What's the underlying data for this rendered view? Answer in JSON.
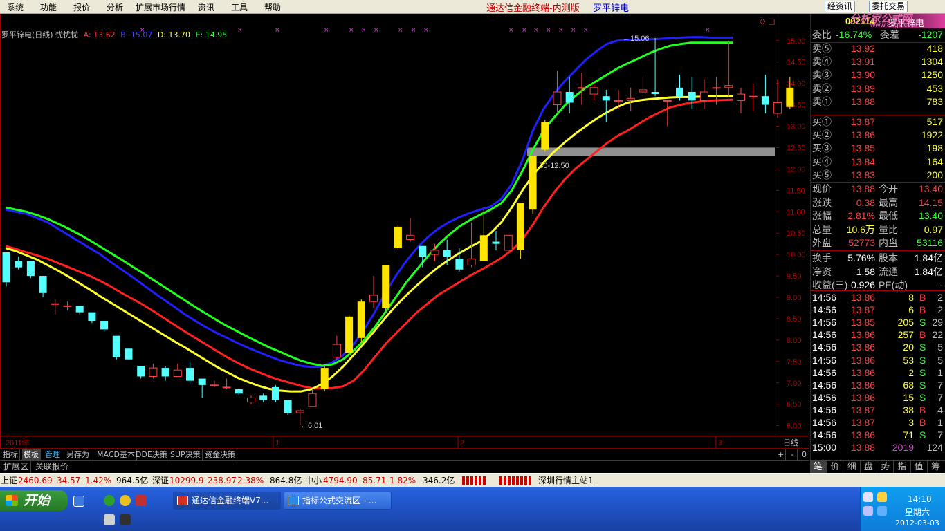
{
  "menu": {
    "items": [
      "系统",
      "功能",
      "报价",
      "分析",
      "扩展市场行情",
      "资讯",
      "工具",
      "帮助"
    ]
  },
  "app_title": "通达信金融终端-内测版",
  "stock_title": "罗平锌电",
  "top_buttons": [
    "经资讯",
    "委托交易"
  ],
  "legend": {
    "name": "罗平锌电(日线) 忧忧忧",
    "a": "A: 13.62",
    "b": "B: 15.07",
    "d": "D: 13.70",
    "e": "E: 14.95",
    "colors": {
      "a": "#ff3030",
      "b": "#4040ff",
      "d": "#ffff40",
      "e": "#40ff40"
    }
  },
  "chart_labels": {
    "high_mark": "15.06",
    "low_mark": "6.01",
    "band": "12.30-12.50",
    "date_year": "2011年",
    "date_1": "1",
    "date_2": "2",
    "date_3": "3",
    "period": "日线"
  },
  "chart_data": {
    "type": "candlestick",
    "ylim": [
      5.8,
      15.4
    ],
    "yticks": [
      "15.00",
      "14.50",
      "14.00",
      "13.50",
      "13.00",
      "12.50",
      "12.00",
      "11.50",
      "11.00",
      "10.50",
      "10.00",
      "9.50",
      "9.00",
      "8.50",
      "8.00",
      "7.50",
      "7.00",
      "6.50",
      "6.00"
    ],
    "candles": [
      [
        10.05,
        9.35,
        10.05,
        9.25
      ],
      [
        9.85,
        9.7,
        9.95,
        9.65
      ],
      [
        9.85,
        9.5,
        9.85,
        9.45
      ],
      [
        9.5,
        9.1,
        9.5,
        9.0
      ],
      [
        8.85,
        8.85,
        8.95,
        8.6
      ],
      [
        8.8,
        8.8,
        8.9,
        8.7
      ],
      [
        8.8,
        8.65,
        8.8,
        8.6
      ],
      [
        8.65,
        8.45,
        8.65,
        8.4
      ],
      [
        8.45,
        8.25,
        8.45,
        8.2
      ],
      [
        8.1,
        7.6,
        8.1,
        7.55
      ],
      [
        7.8,
        7.55,
        7.8,
        7.55
      ],
      [
        7.4,
        7.15,
        7.4,
        7.1
      ],
      [
        7.15,
        7.35,
        7.45,
        7.1
      ],
      [
        7.35,
        7.15,
        7.4,
        7.05
      ],
      [
        7.15,
        7.3,
        7.45,
        7.15
      ],
      [
        7.35,
        7.05,
        7.5,
        7.0
      ],
      [
        7.1,
        6.95,
        7.1,
        6.65
      ],
      [
        6.95,
        6.95,
        7.05,
        6.9
      ],
      [
        6.9,
        6.9,
        7.1,
        6.85
      ],
      [
        6.85,
        6.75,
        6.85,
        6.7
      ],
      [
        6.55,
        6.65,
        6.7,
        6.5
      ],
      [
        6.7,
        6.6,
        6.75,
        6.55
      ],
      [
        6.9,
        6.6,
        6.95,
        6.55
      ],
      [
        6.6,
        6.3,
        6.6,
        6.25
      ],
      [
        6.3,
        6.35,
        6.4,
        6.01
      ],
      [
        6.45,
        6.75,
        6.85,
        6.45
      ],
      [
        6.85,
        7.35,
        7.4,
        6.8
      ],
      [
        7.6,
        7.9,
        8.1,
        7.55
      ],
      [
        7.7,
        8.55,
        8.6,
        7.7
      ],
      [
        8.05,
        8.9,
        8.95,
        7.95
      ],
      [
        8.9,
        9.05,
        9.5,
        8.75
      ],
      [
        8.75,
        9.75,
        9.75,
        8.7
      ],
      [
        10.15,
        10.65,
        10.7,
        10.1
      ],
      [
        10.35,
        10.45,
        10.85,
        10.3
      ],
      [
        10.2,
        9.95,
        10.2,
        9.7
      ],
      [
        10.0,
        10.1,
        10.25,
        9.85
      ],
      [
        10.1,
        9.95,
        10.35,
        9.75
      ],
      [
        9.9,
        9.65,
        10.15,
        9.6
      ],
      [
        9.75,
        9.9,
        10.75,
        9.7
      ],
      [
        9.85,
        10.45,
        11.05,
        9.85
      ],
      [
        10.3,
        10.25,
        10.55,
        10.1
      ],
      [
        10.1,
        10.45,
        10.45,
        10.1
      ],
      [
        10.1,
        11.2,
        11.2,
        9.9
      ],
      [
        11.05,
        12.3,
        12.3,
        10.95
      ],
      [
        12.45,
        13.1,
        13.15,
        12.4
      ],
      [
        13.5,
        13.8,
        14.3,
        13.3
      ],
      [
        13.8,
        13.55,
        14.15,
        13.3
      ],
      [
        13.9,
        13.9,
        14.25,
        13.5
      ],
      [
        13.75,
        13.9,
        14.0,
        13.6
      ],
      [
        13.7,
        13.6,
        13.85,
        13.1
      ],
      [
        13.6,
        13.6,
        13.85,
        13.4
      ],
      [
        13.6,
        13.65,
        13.9,
        13.35
      ],
      [
        13.8,
        13.85,
        14.15,
        13.7
      ],
      [
        13.8,
        13.75,
        15.06,
        13.7
      ],
      [
        13.6,
        13.6,
        13.6,
        13.0
      ],
      [
        13.9,
        13.7,
        14.2,
        13.6
      ],
      [
        13.8,
        13.6,
        14.15,
        13.4
      ],
      [
        13.6,
        13.8,
        14.1,
        13.4
      ],
      [
        13.9,
        13.9,
        14.15,
        13.5
      ],
      [
        13.9,
        13.95,
        15.0,
        13.7
      ],
      [
        13.6,
        13.75,
        13.9,
        13.3
      ],
      [
        13.7,
        13.7,
        14.0,
        13.35
      ],
      [
        13.7,
        13.5,
        14.2,
        13.3
      ],
      [
        13.3,
        13.55,
        14.1,
        13.2
      ],
      [
        13.45,
        13.9,
        14.15,
        13.4
      ]
    ],
    "series": [
      {
        "name": "A",
        "color": "#ff2020",
        "values": [
          10.2,
          10.13,
          10.05,
          9.98,
          9.9,
          9.8,
          9.7,
          9.6,
          9.5,
          9.38,
          9.25,
          9.1,
          8.97,
          8.83,
          8.68,
          8.52,
          8.36,
          8.2,
          8.05,
          7.9,
          7.75,
          7.6,
          7.47,
          7.35,
          7.25,
          7.15,
          7.07,
          7.0,
          6.93,
          6.88,
          6.87,
          6.88,
          6.92,
          7.05,
          7.3,
          7.6,
          7.9,
          8.15,
          8.4,
          8.65,
          8.85,
          9.05,
          9.2,
          9.35,
          9.5,
          9.63,
          9.77,
          9.92,
          10.1,
          10.35,
          10.7,
          11.1,
          11.45,
          11.75,
          12.0,
          12.2,
          12.4,
          12.6,
          12.77,
          12.9,
          13.05,
          13.2,
          13.32,
          13.44,
          13.5,
          13.55,
          13.58,
          13.6,
          13.61,
          13.62
        ]
      },
      {
        "name": "B",
        "color": "#2020ff",
        "values": [
          11.05,
          11.0,
          10.95,
          10.85,
          10.75,
          10.6,
          10.45,
          10.3,
          10.15,
          10.0,
          9.82,
          9.65,
          9.48,
          9.3,
          9.12,
          8.95,
          8.78,
          8.6,
          8.45,
          8.3,
          8.17,
          8.05,
          7.93,
          7.82,
          7.72,
          7.62,
          7.53,
          7.46,
          7.4,
          7.37,
          7.38,
          7.48,
          7.65,
          7.9,
          8.25,
          8.65,
          9.1,
          9.5,
          9.85,
          10.15,
          10.4,
          10.6,
          10.75,
          10.87,
          10.97,
          11.05,
          11.12,
          11.3,
          11.65,
          12.2,
          12.9,
          13.4,
          13.75,
          14.05,
          14.3,
          14.55,
          14.75,
          14.92,
          15.0,
          15.02,
          15.02,
          15.03,
          15.04,
          15.06,
          15.07,
          15.08,
          15.08,
          15.07,
          15.07,
          15.07
        ]
      },
      {
        "name": "D",
        "color": "#ffff30",
        "values": [
          10.15,
          10.08,
          9.98,
          9.88,
          9.75,
          9.62,
          9.48,
          9.33,
          9.18,
          9.02,
          8.87,
          8.72,
          8.57,
          8.42,
          8.27,
          8.12,
          7.97,
          7.83,
          7.68,
          7.53,
          7.38,
          7.25,
          7.12,
          7.02,
          6.93,
          6.86,
          6.82,
          6.8,
          6.8,
          6.85,
          6.97,
          7.15,
          7.38,
          7.65,
          7.93,
          8.22,
          8.52,
          8.8,
          9.05,
          9.28,
          9.5,
          9.7,
          9.87,
          10.03,
          10.17,
          10.3,
          10.5,
          10.75,
          11.1,
          11.5,
          11.85,
          12.15,
          12.4,
          12.62,
          12.82,
          13.0,
          13.17,
          13.32,
          13.45,
          13.55,
          13.6,
          13.63,
          13.65,
          13.67,
          13.68,
          13.68,
          13.69,
          13.7,
          13.7,
          13.7
        ]
      },
      {
        "name": "E",
        "color": "#20ff20",
        "values": [
          11.1,
          11.05,
          11.0,
          10.92,
          10.83,
          10.72,
          10.6,
          10.47,
          10.33,
          10.18,
          10.03,
          9.88,
          9.72,
          9.57,
          9.41,
          9.25,
          9.09,
          8.93,
          8.77,
          8.62,
          8.47,
          8.33,
          8.2,
          8.07,
          7.95,
          7.83,
          7.73,
          7.62,
          7.52,
          7.45,
          7.4,
          7.43,
          7.55,
          7.75,
          8.0,
          8.3,
          8.65,
          9.0,
          9.35,
          9.65,
          9.95,
          10.22,
          10.45,
          10.65,
          10.8,
          10.93,
          11.05,
          11.2,
          11.5,
          11.95,
          12.45,
          12.9,
          13.2,
          13.48,
          13.7,
          13.9,
          14.05,
          14.2,
          14.35,
          14.47,
          14.58,
          14.7,
          14.8,
          14.88,
          14.92,
          14.95,
          14.95,
          14.95,
          14.95,
          14.95
        ]
      }
    ]
  },
  "bottom_tabs": [
    "指标",
    "模板",
    "管理",
    "另存为",
    "MACD基本",
    "DDE决策",
    "SUP决策",
    "资金决策"
  ],
  "bottom_right": [
    "+",
    "-",
    "0"
  ],
  "ext_tabs": [
    "扩展区",
    "关联报价"
  ],
  "quote": {
    "code": "002114",
    "name": "罗平锌电",
    "site": "www.88gs.com",
    "logo": "分析家公式网",
    "weibi_label": "委比",
    "weibi": "-16.74%",
    "weicha_label": "委差",
    "weicha": "-1207",
    "asks": [
      {
        "label": "卖⑤",
        "price": "13.92",
        "vol": "418"
      },
      {
        "label": "卖④",
        "price": "13.91",
        "vol": "1304"
      },
      {
        "label": "卖③",
        "price": "13.90",
        "vol": "1250"
      },
      {
        "label": "卖②",
        "price": "13.89",
        "vol": "453"
      },
      {
        "label": "卖①",
        "price": "13.88",
        "vol": "783"
      }
    ],
    "bids": [
      {
        "label": "买①",
        "price": "13.87",
        "vol": "517"
      },
      {
        "label": "买②",
        "price": "13.86",
        "vol": "1922"
      },
      {
        "label": "买③",
        "price": "13.85",
        "vol": "198"
      },
      {
        "label": "买④",
        "price": "13.84",
        "vol": "164"
      },
      {
        "label": "买⑤",
        "price": "13.83",
        "vol": "200"
      }
    ],
    "stats": [
      [
        "现价",
        "13.88",
        "今开",
        "13.40"
      ],
      [
        "涨跌",
        "0.38",
        "最高",
        "14.15"
      ],
      [
        "涨幅",
        "2.81%",
        "最低",
        "13.40"
      ],
      [
        "总量",
        "10.6万",
        "量比",
        "0.97"
      ],
      [
        "外盘",
        "52773",
        "内盘",
        "53116"
      ],
      [
        "换手",
        "5.76%",
        "股本",
        "1.84亿"
      ],
      [
        "净资",
        "1.58",
        "流通",
        "1.84亿"
      ],
      [
        "收益(三)",
        "-0.926",
        "PE(动)",
        "-"
      ]
    ],
    "ticks": [
      [
        "14:56",
        "13.86",
        "8",
        "B",
        "2"
      ],
      [
        "14:56",
        "13.87",
        "6",
        "B",
        "2"
      ],
      [
        "14:56",
        "13.85",
        "205",
        "S",
        "29"
      ],
      [
        "14:56",
        "13.86",
        "257",
        "B",
        "22"
      ],
      [
        "14:56",
        "13.86",
        "20",
        "S",
        "5"
      ],
      [
        "14:56",
        "13.86",
        "53",
        "S",
        "5"
      ],
      [
        "14:56",
        "13.86",
        "2",
        "S",
        "1"
      ],
      [
        "14:56",
        "13.86",
        "68",
        "S",
        "7"
      ],
      [
        "14:56",
        "13.86",
        "15",
        "S",
        "7"
      ],
      [
        "14:56",
        "13.87",
        "38",
        "B",
        "4"
      ],
      [
        "14:56",
        "13.87",
        "3",
        "B",
        "1"
      ],
      [
        "14:56",
        "13.86",
        "71",
        "S",
        "7"
      ],
      [
        "15:00",
        "13.88",
        "2019",
        "",
        "124"
      ]
    ]
  },
  "right_tabs": [
    "笔",
    "价",
    "细",
    "盘",
    "势",
    "指",
    "值",
    "筹"
  ],
  "status": {
    "sh_label": "上证",
    "sh": "2460.69",
    "sh_chg": "34.57",
    "sh_pct": "1.42%",
    "sh_amt": "964.5亿",
    "sz_label": "深证",
    "sz": "10299.9",
    "sz_chg": "238.97",
    "sz_pct": "2.38%",
    "sz_amt": "864.8亿",
    "zx_label": "中小",
    "zx": "4794.90",
    "zx_chg": "85.71",
    "zx_pct": "1.82%",
    "zx_amt": "346.2亿",
    "server": "深圳行情主站1"
  },
  "taskbar": {
    "start": "开始",
    "tasks": [
      "通达信金融终端V7...",
      "指标公式交流区 - ..."
    ],
    "time": "14:10",
    "weekday": "星期六",
    "date": "2012-03-03"
  }
}
